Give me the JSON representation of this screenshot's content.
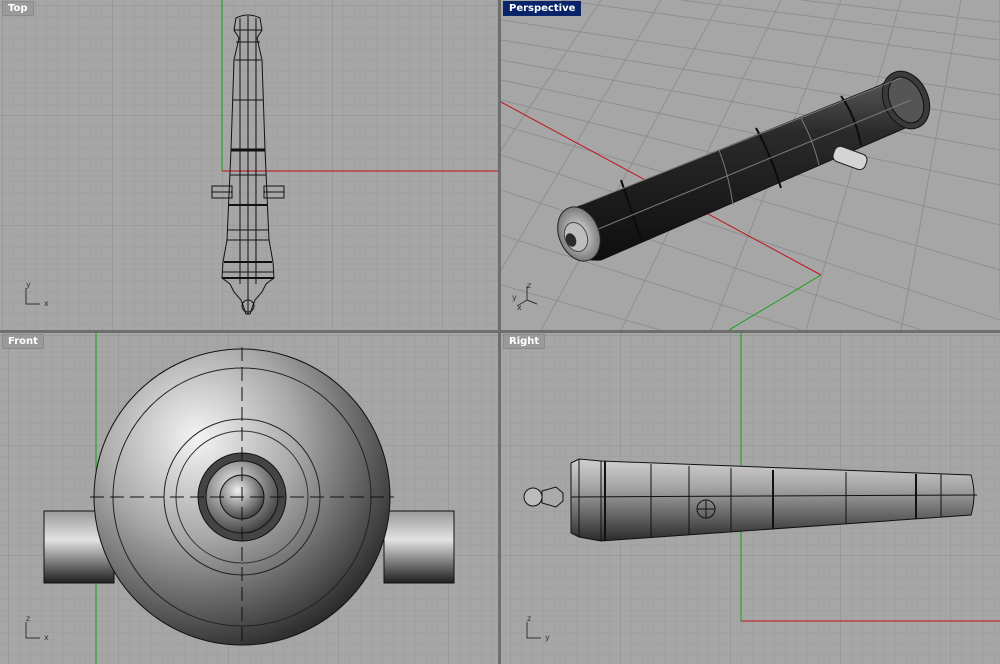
{
  "viewports": {
    "top": {
      "label": "Top",
      "axes": [
        "y",
        "x"
      ]
    },
    "perspective": {
      "label": "Perspective",
      "active": true,
      "axes": [
        "z",
        "y",
        "x"
      ]
    },
    "front": {
      "label": "Front",
      "axes": [
        "z",
        "x"
      ]
    },
    "right": {
      "label": "Right",
      "axes": [
        "z",
        "y"
      ]
    }
  },
  "colors": {
    "viewport_bg": "#a6a6a6",
    "grid_minor": "#9b9b9b",
    "grid_major": "#8c8c8c",
    "x_axis": "#c0141e",
    "y_axis": "#14a014",
    "active_label_bg": "#0a246a",
    "border": "#6e6e6e"
  }
}
